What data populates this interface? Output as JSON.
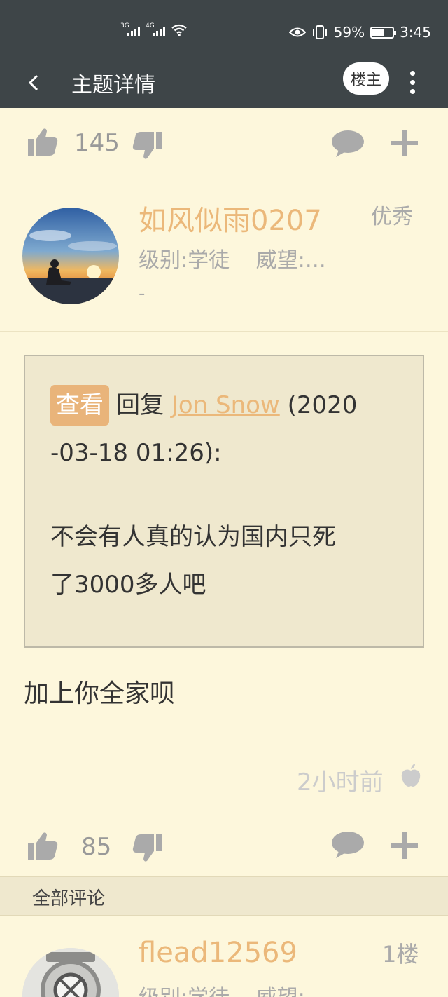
{
  "status_bar": {
    "net1": "3G",
    "net2": "4G",
    "battery_text": "59%",
    "battery_level": 0.59,
    "time": "3:45"
  },
  "app_bar": {
    "title": "主题详情",
    "op_label": "楼主"
  },
  "top_actions": {
    "likes": "145"
  },
  "post": {
    "username": "如风似雨0207",
    "badge": "优秀",
    "level": "级别:学徒",
    "prestige": "威望:…",
    "dash": "-",
    "quote": {
      "view_label": "查看",
      "reply_word": "回复",
      "replied_user": "Jon Snow",
      "date_part1": "(2020",
      "date_part2": "-03-18 01:26):",
      "text_line1": "不会有人真的认为国内只死",
      "text_line2": "了3000多人吧"
    },
    "reply_text": "加上你全家呗",
    "time": "2小时前",
    "likes": "85"
  },
  "section": {
    "label": "全部评论"
  },
  "comment": {
    "username": "flead12569",
    "floor": "1楼",
    "level": "级别:学徒",
    "prestige": "威望:…"
  },
  "colors": {
    "header_bg": "#3e4548",
    "page_bg": "#fdf7dc",
    "accent": "#ebb87a",
    "quote_bg": "#efe8ce",
    "muted": "#aaaaaa"
  },
  "icons": [
    "thumb-up-icon",
    "thumb-down-icon",
    "comment-icon",
    "plus-icon",
    "apple-icon",
    "back-icon",
    "more-icon"
  ]
}
